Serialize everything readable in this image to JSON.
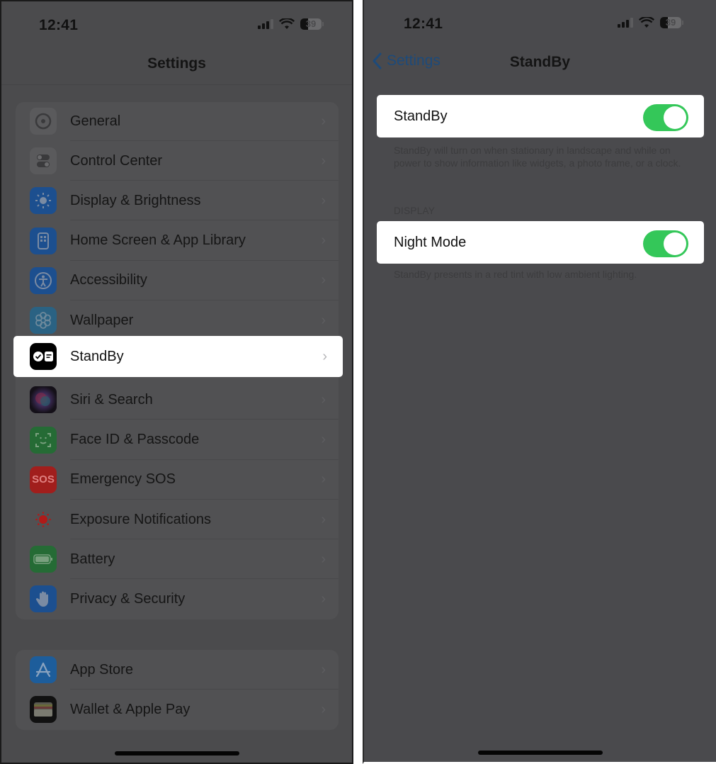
{
  "left_screen": {
    "status": {
      "time": "12:41",
      "battery": "39"
    },
    "title": "Settings",
    "groups": [
      {
        "items": [
          {
            "label": "General",
            "icon": "gear-icon",
            "color": "#5a5a5c"
          },
          {
            "label": "Control Center",
            "icon": "toggles-icon",
            "color": "#5a5a5c"
          },
          {
            "label": "Display & Brightness",
            "icon": "sun-icon",
            "color": "#1c4f8f"
          },
          {
            "label": "Home Screen & App Library",
            "icon": "home-screen-icon",
            "color": "#1c4f8f"
          },
          {
            "label": "Accessibility",
            "icon": "accessibility-icon",
            "color": "#1c4f8f"
          },
          {
            "label": "Wallpaper",
            "icon": "flower-icon",
            "color": "#2a6283"
          },
          {
            "label": "StandBy",
            "icon": "standby-icon",
            "color": "#000000",
            "highlighted": true
          },
          {
            "label": "Siri & Search",
            "icon": "siri-icon",
            "color": "#2b2240"
          },
          {
            "label": "Face ID & Passcode",
            "icon": "face-id-icon",
            "color": "#256b35"
          },
          {
            "label": "Emergency SOS",
            "icon": "sos-icon",
            "color": "#a11e1c",
            "icon_text": "SOS"
          },
          {
            "label": "Exposure Notifications",
            "icon": "exposure-icon",
            "color": "#b01a18"
          },
          {
            "label": "Battery",
            "icon": "battery-icon",
            "color": "#256b35"
          },
          {
            "label": "Privacy & Security",
            "icon": "hand-icon",
            "color": "#1c4f8f"
          }
        ]
      },
      {
        "items": [
          {
            "label": "App Store",
            "icon": "app-store-icon",
            "color": "#1d5d9b"
          },
          {
            "label": "Wallet & Apple Pay",
            "icon": "wallet-icon",
            "color": "#111111"
          }
        ]
      }
    ],
    "chevron": "›"
  },
  "right_screen": {
    "status": {
      "time": "12:41",
      "battery": "39"
    },
    "back_label": "Settings",
    "title": "StandBy",
    "standby": {
      "label": "StandBy",
      "enabled": true,
      "footnote": "StandBy will turn on when stationary in landscape and while on power to show information like widgets, a photo frame, or a clock."
    },
    "display_section": {
      "header": "DISPLAY",
      "night_mode_label": "Night Mode",
      "night_mode_enabled": true,
      "footnote": "StandBy presents in a red tint with low ambient lighting."
    },
    "accent_color": "#34c759"
  }
}
